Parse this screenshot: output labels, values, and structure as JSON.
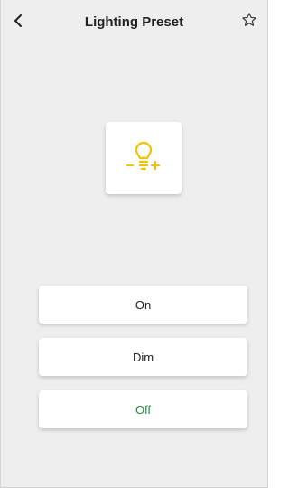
{
  "header": {
    "title": "Lighting Preset",
    "back_icon": "chevron-left-icon",
    "favorite_icon": "star-outline-icon"
  },
  "device_icon": {
    "name": "dimmable-bulb-icon",
    "color": "#f2c200"
  },
  "presets": [
    {
      "label": "On",
      "color": "#222222"
    },
    {
      "label": "Dim",
      "color": "#222222"
    },
    {
      "label": "Off",
      "color": "#1a8a3c"
    }
  ]
}
